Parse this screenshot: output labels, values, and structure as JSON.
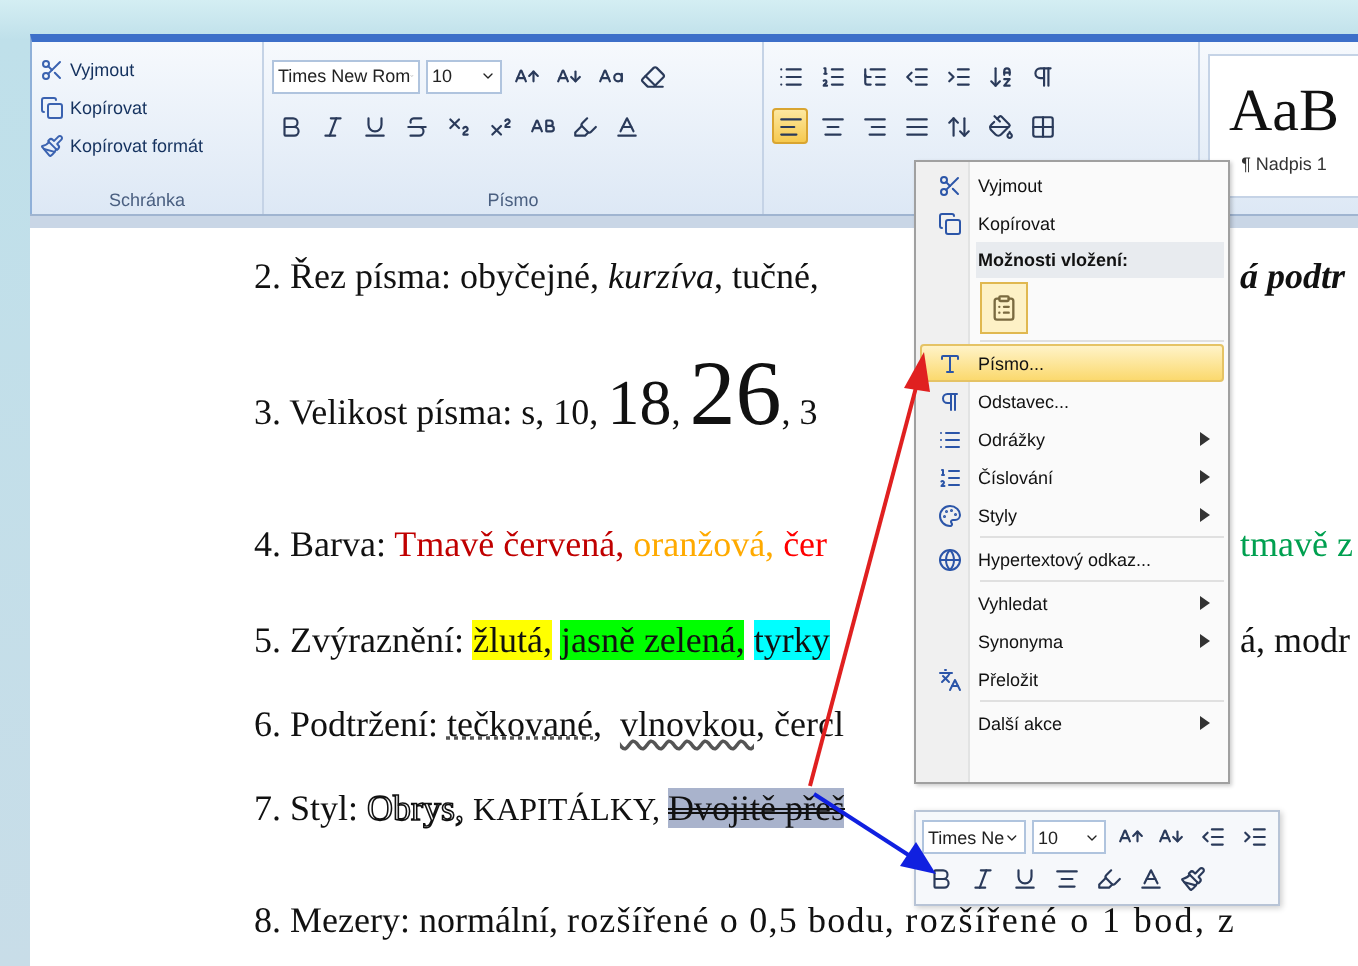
{
  "ribbon": {
    "clipboard": {
      "items": [
        {
          "label": "Vyjmout"
        },
        {
          "label": "Kopírovat"
        },
        {
          "label": "Kopírovat formát"
        }
      ],
      "label": "Schránka"
    },
    "font": {
      "name": "Times New Rom",
      "size": "10",
      "label": "Písmo"
    },
    "paragraph": {
      "alignments": [
        {
          "selected": true
        },
        {
          "selected": false
        },
        {
          "selected": false
        },
        {
          "selected": false
        }
      ]
    },
    "styles": [
      {
        "sample": "AaB",
        "name": "¶ Nadpis 1"
      }
    ]
  },
  "document": {
    "lines": [
      {
        "segments": [
          {
            "text": "2. Řez písma: obyčejné, ",
            "kind": "plain"
          },
          {
            "text": "kurzíva",
            "kind": "italic"
          },
          {
            "text": ", tučné,",
            "kind": "plain"
          }
        ],
        "right": [
          {
            "text": "á podtr",
            "kind": "bold-italic"
          }
        ]
      },
      {
        "segments": [
          {
            "text": "3. Velikost písma: s, 10, ",
            "kind": "plain"
          },
          {
            "text": "18",
            "kind": "large"
          },
          {
            "text": ", ",
            "kind": "plain"
          },
          {
            "text": "26",
            "kind": "larger"
          },
          {
            "text": ", 3",
            "kind": "plain"
          }
        ]
      },
      {
        "segments": [
          {
            "text": "4. Barva: ",
            "kind": "plain"
          },
          {
            "text": "Tmavě červená, ",
            "kind": "colored",
            "color": "#c00000"
          },
          {
            "text": "oranžová, ",
            "kind": "colored",
            "color": "#ffaa00"
          },
          {
            "text": "čer",
            "kind": "colored",
            "color": "#ff0000"
          }
        ],
        "right": [
          {
            "text": "tmavě z",
            "kind": "colored",
            "color": "#00a050"
          }
        ]
      },
      {
        "segments": [
          {
            "text": "5. Zvýraznění: ",
            "kind": "plain"
          },
          {
            "text": "žlutá,",
            "kind": "highlight",
            "color": "#ffff00"
          },
          {
            "text": "jasně zelená,",
            "kind": "highlight",
            "color": "#00ff00"
          },
          {
            "text": "tyrky",
            "kind": "highlight",
            "color": "#00ffff"
          }
        ],
        "right": [
          {
            "text": "á, modr",
            "kind": "plain"
          }
        ]
      },
      {
        "segments": [
          {
            "text": "6. Podtržení: ",
            "kind": "plain"
          },
          {
            "text": "tečkované,",
            "kind": "dotted"
          },
          {
            "text": "vlnovkou,",
            "kind": "wavy"
          },
          {
            "text": " čercl",
            "kind": "plain"
          }
        ]
      },
      {
        "segments": [
          {
            "text": "7. Styl: ",
            "kind": "plain",
            "selected": false
          },
          {
            "text": "Obrys,",
            "kind": "outline",
            "selected": false
          },
          {
            "text": "KAPITÁLKY,",
            "kind": "small-caps",
            "selected": false
          },
          {
            "text": "Dvojitě přeš",
            "kind": "double-strike",
            "selected": true
          }
        ]
      },
      {
        "segments": [
          {
            "text": "8. Mezery: normální, ",
            "kind": "plain"
          },
          {
            "text": "rozšířené o 0,5 bodu, ",
            "kind": "expanded"
          },
          {
            "text": "rozšířené o 1 bod, z",
            "kind": "more-expanded"
          }
        ]
      }
    ]
  },
  "context_menu": {
    "items": [
      {
        "kind": "item",
        "label": "Vyjmout",
        "selected": false
      },
      {
        "kind": "item",
        "label": "Kopírovat",
        "selected": false
      },
      {
        "kind": "header",
        "label": "Možnosti vložení:"
      },
      {
        "kind": "paste-option"
      },
      {
        "kind": "item",
        "label": "Písmo...",
        "selected": true
      },
      {
        "kind": "item",
        "label": "Odstavec...",
        "selected": false
      },
      {
        "kind": "submenu",
        "label": "Odrážky",
        "selected": false
      },
      {
        "kind": "submenu",
        "label": "Číslování",
        "selected": false
      },
      {
        "kind": "submenu",
        "label": "Styly",
        "selected": false
      },
      {
        "kind": "item",
        "label": "Hypertextový odkaz...",
        "selected": false
      },
      {
        "kind": "submenu",
        "label": "Vyhledat",
        "selected": false
      },
      {
        "kind": "submenu",
        "label": "Synonyma",
        "selected": false
      },
      {
        "kind": "item",
        "label": "Přeložit",
        "selected": false
      },
      {
        "kind": "submenu",
        "label": "Další akce",
        "selected": false
      }
    ]
  },
  "mini_toolbar": {
    "font": "Times Ne",
    "size": "10"
  }
}
